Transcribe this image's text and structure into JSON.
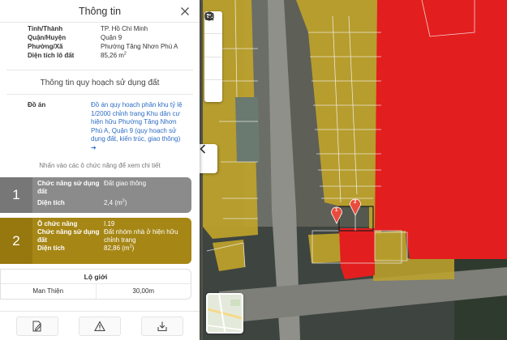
{
  "panel": {
    "title": "Thông tin",
    "close_icon": "close-icon"
  },
  "location": [
    {
      "label": "Tỉnh/Thành",
      "value": "TP. Hồ Chí Minh"
    },
    {
      "label": "Quận/Huyện",
      "value": "Quận 9"
    },
    {
      "label": "Phường/Xã",
      "value": "Phường Tăng Nhơn Phú A"
    },
    {
      "label": "Diện tích lô đất",
      "value": "85,26 m",
      "sup": "2"
    }
  ],
  "planning": {
    "section_title": "Thông tin quy hoạch sử dụng đất",
    "doan_label": "Đồ án",
    "doan_text": "Đồ án quy hoạch phân khu tỷ lệ 1/2000 chỉnh trang Khu dân cư hiện hữu Phường Tăng Nhơn Phú A, Quận 9 (quy hoạch sử dụng đất, kiến trúc, giao thông)",
    "doan_arrow": "➔",
    "hint": "Nhấn vào các ô chức năng để xem chi tiết"
  },
  "zones": [
    {
      "number": "1",
      "color": "#8b8b8b",
      "function_label": "Chức năng sử dụng đất",
      "function_value": "Đất giao thông",
      "area_label": "Diện tích",
      "area_value": "2,4 (m",
      "area_sup": "2",
      "area_close": ")"
    },
    {
      "number": "2",
      "color": "#a68615",
      "cell_label": "Ô chức năng",
      "cell_value": "I.19",
      "function_label": "Chức năng sử dụng đất",
      "function_value": "Đất nhóm nhà ở hiện hữu chỉnh trang",
      "area_label": "Diện tích",
      "area_value": "82,86 (m",
      "area_sup": "2",
      "area_close": ")"
    }
  ],
  "setback": {
    "title": "Lộ giới",
    "street": "Man Thiện",
    "width": "30,00m"
  },
  "footer": {
    "buttons": [
      "edit-document-icon",
      "warning-icon",
      "download-icon"
    ]
  },
  "map": {
    "tools": [
      "search-icon",
      "layers-icon",
      "legend-icon",
      "info-icon"
    ],
    "pins": [
      "1",
      "2"
    ],
    "colors": {
      "residential": "#bfa32a",
      "commercial_red": "#e31e1e",
      "road": "#8a8a88"
    }
  }
}
